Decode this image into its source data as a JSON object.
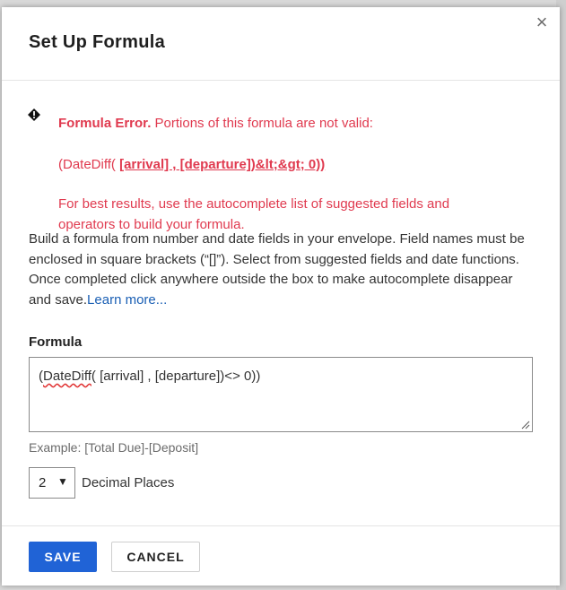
{
  "dialog": {
    "title": "Set Up Formula",
    "close_glyph": "×"
  },
  "error": {
    "icon": "diamond-exclamation-icon",
    "heading": "Formula Error.",
    "message": " Portions of this formula are not valid:",
    "formula_prefix": "(DateDiff( ",
    "formula_invalid": "[arrival] , [departure])&lt;&gt; 0))",
    "hint_line1": "For best results, use the autocomplete list of suggested fields and",
    "hint_line2": "operators to build your formula.",
    "color": "#e03a4f"
  },
  "description": {
    "text": "Build a formula from number and date fields in your envelope. Field names must be enclosed in square brackets (“[]”). Select from suggested fields and date functions. Once completed click anywhere outside the box to make autocomplete disappear and save.",
    "link_text": "Learn more..."
  },
  "formula": {
    "label": "Formula",
    "value_open_paren": "(",
    "value_flagged_word": "DateDiff",
    "value_rest": "( [arrival] , [departure])<> 0))",
    "example": "Example: [Total Due]-[Deposit]"
  },
  "decimal": {
    "selected": "2",
    "arrow": "▼",
    "label": "Decimal Places"
  },
  "footer": {
    "save_label": "SAVE",
    "cancel_label": "CANCEL",
    "accent_color": "#2063d6"
  }
}
